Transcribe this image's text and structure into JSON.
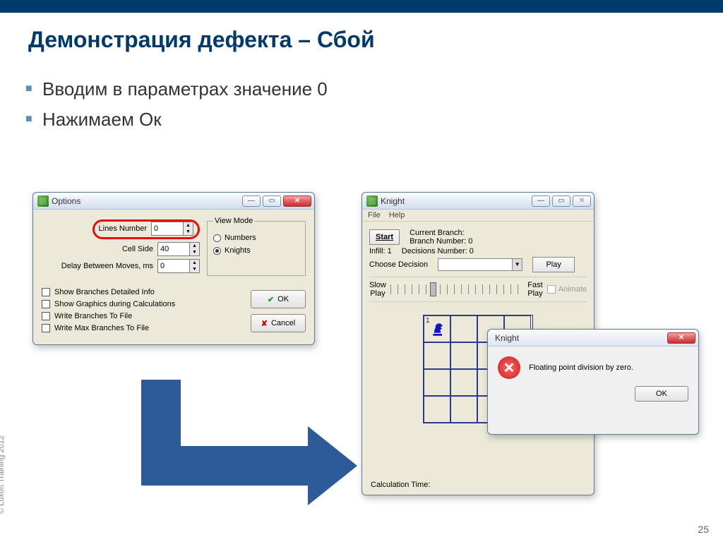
{
  "slide": {
    "title": "Демонстрация дефекта – Сбой",
    "bullets": [
      "Вводим в параметрах значение 0",
      "Нажимаем Ок"
    ],
    "copyright": "© Luxoft Training 2012",
    "pagenum": "25"
  },
  "options": {
    "title": "Options",
    "lines_number_label": "Lines Number",
    "lines_number_value": "0",
    "cell_side_label": "Cell Side",
    "cell_side_value": "40",
    "delay_label": "Delay Between Moves, ms",
    "delay_value": "0",
    "view_mode_label": "View Mode",
    "view_numbers": "Numbers",
    "view_knights": "Knights",
    "chk_detailed": "Show Branches Detailed Info",
    "chk_graphics": "Show Graphics during Calculations",
    "chk_writebr": "Write Branches To File",
    "chk_writemax": "Write Max Branches To File",
    "ok": "OK",
    "cancel": "Cancel"
  },
  "knight": {
    "title": "Knight",
    "menu_file": "File",
    "menu_help": "Help",
    "start": "Start",
    "current_branch": "Current Branch:",
    "branch_number": "Branch Number: 0",
    "infill": "Infill: 1",
    "decisions": "Decisions Number: 0",
    "choose_decision": "Choose Decision",
    "play": "Play",
    "slow": "Slow\nPlay",
    "fast": "Fast\nPlay",
    "animate": "Animate",
    "board_cell1": "1",
    "calc_time": "Calculation Time:"
  },
  "err": {
    "title": "Knight",
    "msg": "Floating point division by zero.",
    "ok": "OK"
  }
}
